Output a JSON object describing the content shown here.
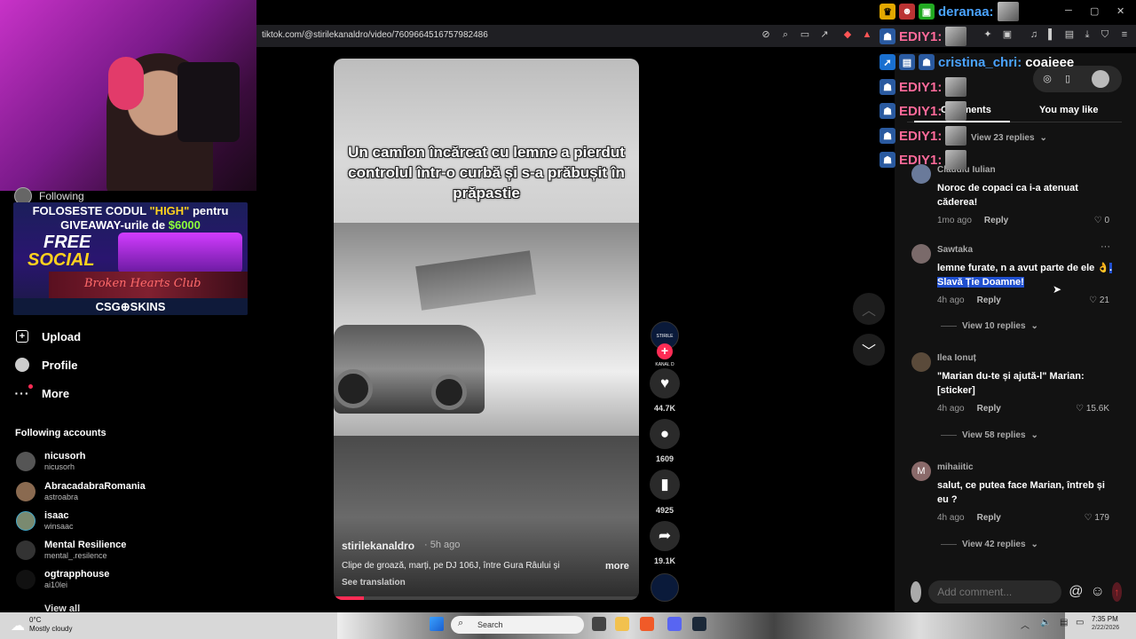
{
  "browser": {
    "url": "tiktok.com/@stirilekanaldro/video/7609664516757982486",
    "window_controls": {
      "minimize": "─",
      "maximize": "▢",
      "close": "✕"
    }
  },
  "sidebar": {
    "following_label": "Following",
    "promo": {
      "line1_pre": "FOLOSESTE CODUL ",
      "line1_code": "\"HIGH\"",
      "line1_post": " pentru",
      "line2_pre": "GIVEAWAY-urile de ",
      "line2_amount": "$6000",
      "free": "FREE",
      "social": "SOCIAL",
      "club": "Broken Hearts Club",
      "brand": "CSG⊕SKINS"
    },
    "nav": [
      {
        "label": "Upload",
        "icon": "upload-icon"
      },
      {
        "label": "Profile",
        "icon": "profile-icon"
      },
      {
        "label": "More",
        "icon": "more-icon"
      }
    ],
    "following_accounts_title": "Following accounts",
    "accounts": [
      {
        "name": "nicusorh",
        "handle": "nicusorh"
      },
      {
        "name": "AbracadabraRomania",
        "handle": "astroabra"
      },
      {
        "name": "isaac",
        "handle": "winsaac"
      },
      {
        "name": "Mental Resilience",
        "handle": "mental_.resilence"
      },
      {
        "name": "ogtrapphouse",
        "handle": "ai10lei"
      }
    ],
    "view_all": "View all"
  },
  "video": {
    "caption": "Un camion încărcat cu lemne a pierdut controlul într-o curbă și s-a prăbușit în prăpastie",
    "author": "stirilekanaldro",
    "time": "· 5h ago",
    "description": "Clipe de groază, marți, pe DJ 106J, între Gura Râului și",
    "more": "more",
    "see_translation": "See translation",
    "progress": 0.1
  },
  "actions": {
    "avatar_text": "STIRILE KANAL D",
    "plus": "+",
    "likes": "44.7K",
    "comments": "1609",
    "saves": "4925",
    "shares": "19.1K"
  },
  "chat": {
    "lines": [
      {
        "user": "deranaa:",
        "color": "#4aa3ff"
      },
      {
        "user": "EDIY1:",
        "color": "#ff6a9a"
      },
      {
        "user": "cristina_chri:",
        "color": "#4aa3ff",
        "message": "coaieee"
      },
      {
        "user": "EDIY1:",
        "color": "#ff6a9a"
      },
      {
        "user": "EDIY1:",
        "color": "#ff6a9a"
      },
      {
        "user": "EDIY1:",
        "color": "#ff6a9a"
      },
      {
        "user": "EDIY1:",
        "color": "#ff6a9a"
      }
    ]
  },
  "panel": {
    "tabs": {
      "comments": "Comments",
      "you_may_like": "You may like"
    },
    "partial_replies": "View 23 replies",
    "comments": [
      {
        "user": "Claudiu Iulian",
        "text": "Noroc de copaci ca i-a atenuat căderea!",
        "time": "1mo ago",
        "reply": "Reply",
        "likes": "0"
      },
      {
        "user": "Sawtaka",
        "text_pre": "lemne furate, n a avut parte de ele 👌",
        "text_sel": ". Slavă Ție Doamne!",
        "time": "4h ago",
        "reply": "Reply",
        "likes": "21",
        "replies": "View 10 replies",
        "options": "···"
      },
      {
        "user": "Ilea Ionuț",
        "text": "\"Marian du-te și ajută-l\" Marian: [sticker]",
        "time": "4h ago",
        "reply": "Reply",
        "likes": "15.6K",
        "replies": "View 58 replies"
      },
      {
        "user": "mihaiitic",
        "text": "salut, ce putea face Marian, întreb și eu ?",
        "time": "4h ago",
        "reply": "Reply",
        "likes": "179",
        "replies": "View 42 replies",
        "avatar_letter": "M"
      }
    ],
    "add_comment_placeholder": "Add comment..."
  },
  "taskbar": {
    "temp": "0°C",
    "weather": "Mostly cloudy",
    "search": "Search",
    "time": "7:35 PM",
    "date": "2/22/2026"
  }
}
